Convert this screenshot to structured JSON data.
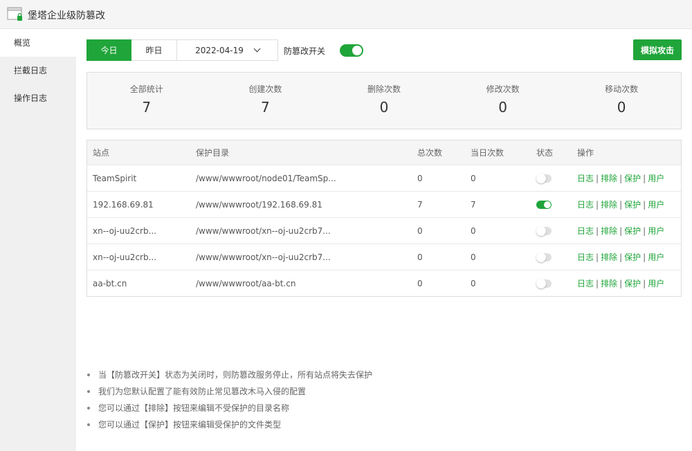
{
  "app": {
    "title": "堡塔企业级防篡改"
  },
  "sidebar": {
    "items": [
      {
        "label": "概览"
      },
      {
        "label": "拦截日志"
      },
      {
        "label": "操作日志"
      }
    ]
  },
  "toolbar": {
    "today_label": "今日",
    "yesterday_label": "昨日",
    "date": "2022-04-19",
    "switch_label": "防篡改开关",
    "switch_on": true,
    "attack_button": "模拟攻击"
  },
  "stats": [
    {
      "label": "全部统计",
      "value": "7"
    },
    {
      "label": "创建次数",
      "value": "7"
    },
    {
      "label": "删除次数",
      "value": "0"
    },
    {
      "label": "修改次数",
      "value": "0"
    },
    {
      "label": "移动次数",
      "value": "0"
    }
  ],
  "table": {
    "headers": {
      "site": "站点",
      "dir": "保护目录",
      "total": "总次数",
      "today": "当日次数",
      "state": "状态",
      "ops": "操作"
    },
    "ops": {
      "log": "日志",
      "exclude": "排除",
      "protect": "保护",
      "user": "用户",
      "sep": "|"
    },
    "rows": [
      {
        "site": "TeamSpirit",
        "dir": "/www/wwwroot/node01/TeamSp...",
        "total": "0",
        "today": "0",
        "enabled": false
      },
      {
        "site": "192.168.69.81",
        "dir": "/www/wwwroot/192.168.69.81",
        "total": "7",
        "today": "7",
        "enabled": true
      },
      {
        "site": "xn--oj-uu2crb...",
        "dir": "/www/wwwroot/xn--oj-uu2crb7...",
        "total": "0",
        "today": "0",
        "enabled": false
      },
      {
        "site": "xn--oj-uu2crb...",
        "dir": "/www/wwwroot/xn--oj-uu2crb7...",
        "total": "0",
        "today": "0",
        "enabled": false
      },
      {
        "site": "aa-bt.cn",
        "dir": "/www/wwwroot/aa-bt.cn",
        "total": "0",
        "today": "0",
        "enabled": false
      }
    ]
  },
  "tips": [
    "当【防篡改开关】状态为关闭时，则防篡改服务停止，所有站点将失去保护",
    "我们为您默认配置了能有效防止常见篡改木马入侵的配置",
    "您可以通过【排除】按钮来编辑不受保护的目录名称",
    "您可以通过【保护】按钮来编辑受保护的文件类型"
  ],
  "colors": {
    "accent": "#20a53a"
  }
}
